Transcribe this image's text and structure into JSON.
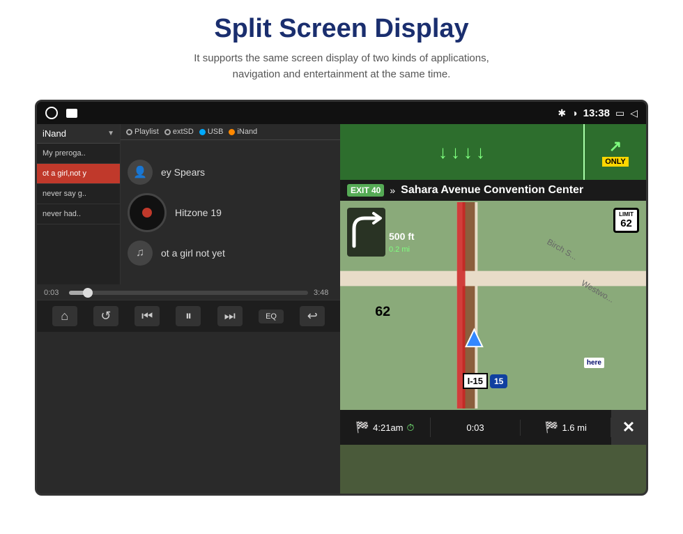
{
  "header": {
    "title": "Split Screen Display",
    "subtitle_line1": "It supports the same screen display of two kinds of applications,",
    "subtitle_line2": "navigation and entertainment at the same time."
  },
  "statusBar": {
    "time": "13:38",
    "icons": [
      "bluetooth",
      "location",
      "window",
      "back"
    ]
  },
  "musicPanel": {
    "storageSelector": "iNand",
    "sourceTabs": [
      "Playlist",
      "extSD",
      "USB",
      "iNand"
    ],
    "playlist": [
      {
        "title": "My preroga..",
        "active": false
      },
      {
        "title": "ot a girl,not y",
        "active": true
      },
      {
        "title": "never say g..",
        "active": false
      },
      {
        "title": "never had..",
        "active": false
      }
    ],
    "currentTrack": {
      "artist": "ey Spears",
      "album": "Hitzone 19",
      "song": "ot a girl not yet"
    },
    "progress": {
      "current": "0:03",
      "total": "3:48",
      "percent": 8
    },
    "controls": [
      "home",
      "repeat",
      "prev",
      "play-pause",
      "next",
      "eq",
      "back"
    ]
  },
  "navPanel": {
    "exitSign": "EXIT 40",
    "destination": "Sahara Avenue Convention Center",
    "speedLimit": "62",
    "highway": "I-15",
    "highwayShield": "15",
    "distance": "500 ft",
    "distanceMi": "0.2 mi",
    "onlyLabel": "ONLY",
    "stats": [
      {
        "icon": "🏁",
        "main": "4:21am",
        "sub": ""
      },
      {
        "icon": "⏱",
        "main": "0:03",
        "sub": ""
      },
      {
        "icon": "🏁",
        "main": "1.6 mi",
        "sub": ""
      }
    ]
  },
  "controls": {
    "home_label": "⌂",
    "repeat_label": "↺",
    "prev_label": "⏮",
    "pause_label": "⏸",
    "next_label": "⏭",
    "eq_label": "EQ",
    "back_label": "↩"
  }
}
